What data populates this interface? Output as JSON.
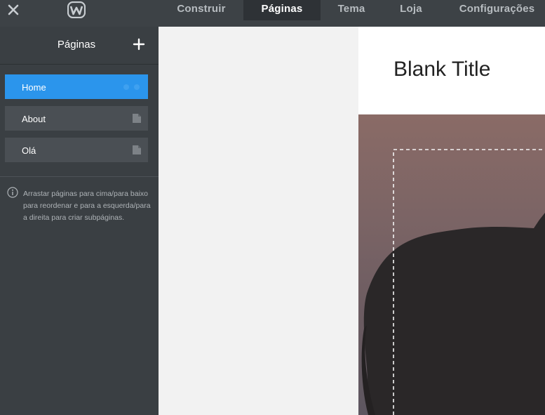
{
  "topbar": {
    "tabs": [
      {
        "label": "Construir"
      },
      {
        "label": "Páginas"
      },
      {
        "label": "Tema"
      },
      {
        "label": "Loja"
      },
      {
        "label": "Configurações"
      }
    ],
    "active_tab": "Páginas"
  },
  "sidebar": {
    "title": "Páginas",
    "pages": [
      {
        "label": "Home",
        "active": true
      },
      {
        "label": "About",
        "active": false
      },
      {
        "label": "Olá",
        "active": false
      }
    ],
    "hint": "Arrastar páginas para cima/para baixo para reordenar e para a esquerda/para a direita para criar subpáginas."
  },
  "editor": {
    "page_title": "Blank Title"
  },
  "colors": {
    "topbar_bg": "#3d4246",
    "sidebar_bg": "#3a3f43",
    "active_item": "#2b95ec",
    "item_bg": "#4a4f54"
  },
  "icons": [
    "close-icon",
    "weebly-logo-icon",
    "plus-icon",
    "page-icon",
    "info-icon"
  ]
}
